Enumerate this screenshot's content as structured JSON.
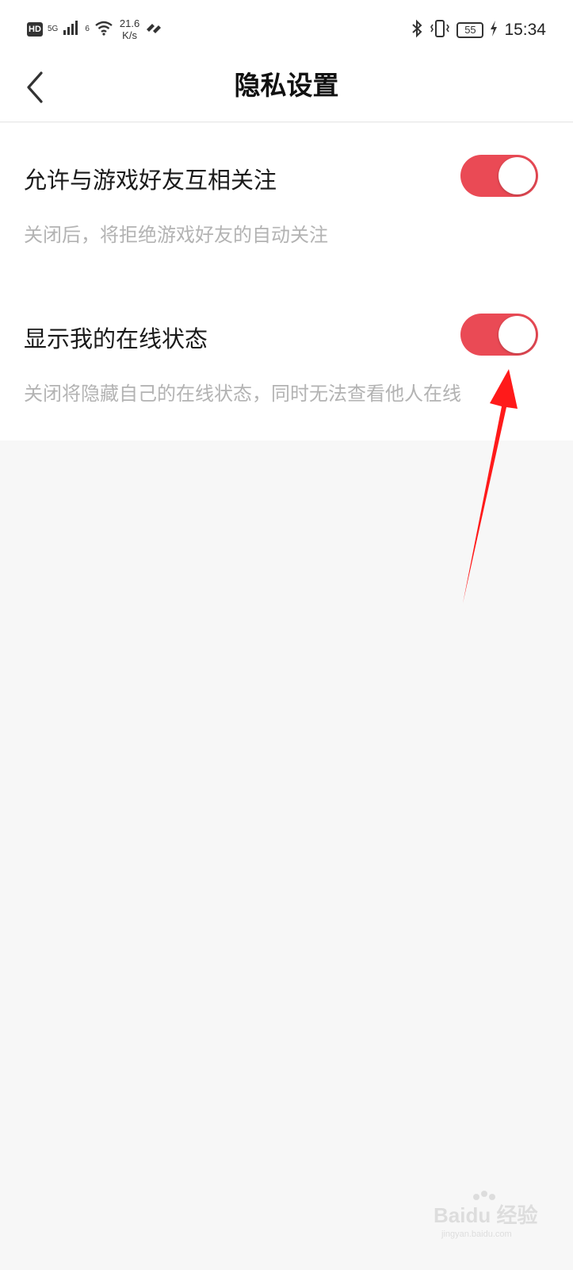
{
  "status_bar": {
    "hd_label": "HD",
    "network_label": "5G",
    "wifi_label": "6",
    "speed_value": "21.6",
    "speed_unit": "K/s",
    "battery": "55",
    "time": "15:34"
  },
  "header": {
    "title": "隐私设置"
  },
  "settings": [
    {
      "title": "允许与游戏好友互相关注",
      "description": "关闭后，将拒绝游戏好友的自动关注",
      "enabled": true
    },
    {
      "title": "显示我的在线状态",
      "description": "关闭将隐藏自己的在线状态，同时无法查看他人在线",
      "enabled": true
    }
  ],
  "watermark": {
    "text": "Baidu 经验",
    "subtext": "jingyan.baidu.com"
  },
  "colors": {
    "accent": "#ea4a55",
    "annotation": "#ff1a1a",
    "background": "#f7f7f7"
  }
}
